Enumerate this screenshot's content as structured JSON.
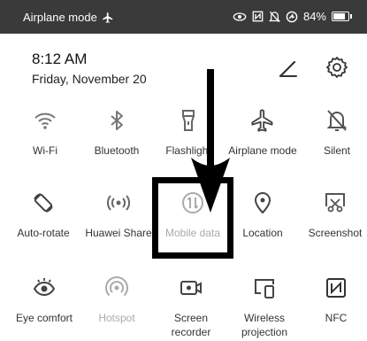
{
  "status_bar": {
    "left_text": "Airplane mode",
    "battery_text": "84%",
    "battery_level": 0.84,
    "icons": [
      "airplane-icon",
      "eye-comfort-icon",
      "nfc-icon",
      "silent-icon",
      "charging-icon",
      "battery-icon"
    ]
  },
  "header": {
    "time": "8:12 AM",
    "date": "Friday, November 20"
  },
  "toggles": [
    {
      "label": "Wi-Fi",
      "icon": "wifi-icon"
    },
    {
      "label": "Bluetooth",
      "icon": "bluetooth-icon"
    },
    {
      "label": "Flashlight",
      "icon": "flashlight-icon"
    },
    {
      "label": "Airplane mode",
      "icon": "airplane-icon"
    },
    {
      "label": "Silent",
      "icon": "silent-icon"
    },
    {
      "label": "Auto-rotate",
      "icon": "rotate-icon"
    },
    {
      "label": "Huawei Share",
      "icon": "share-icon"
    },
    {
      "label": "Mobile data",
      "icon": "mobile-data-icon"
    },
    {
      "label": "Location",
      "icon": "location-icon"
    },
    {
      "label": "Screenshot",
      "icon": "screenshot-icon"
    },
    {
      "label": "Eye comfort",
      "icon": "eye-icon"
    },
    {
      "label": "Hotspot",
      "icon": "hotspot-icon"
    },
    {
      "label": "Screen recorder",
      "icon": "screen-recorder-icon"
    },
    {
      "label": "Wireless projection",
      "icon": "projection-icon"
    },
    {
      "label": "NFC",
      "icon": "nfc-icon"
    }
  ]
}
